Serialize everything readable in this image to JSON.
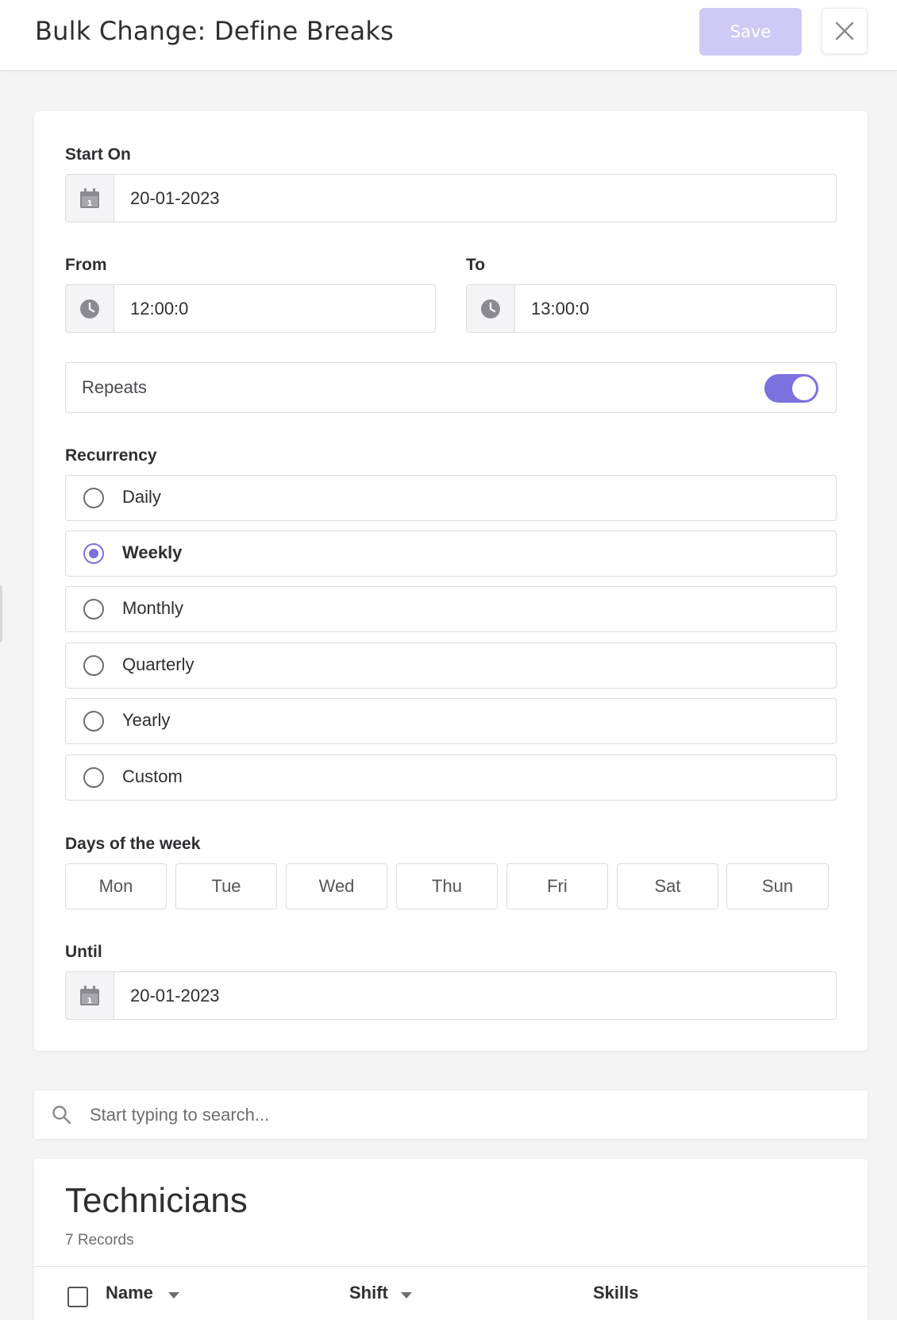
{
  "header": {
    "title": "Bulk Change: Define Breaks",
    "save_label": "Save",
    "close_icon": "close-icon"
  },
  "form": {
    "start_on_label": "Start On",
    "start_on_value": "20-01-2023",
    "from_label": "From",
    "from_value": "12:00:0",
    "to_label": "To",
    "to_value": "13:00:0",
    "repeats_label": "Repeats",
    "repeats_on": true,
    "recurrency_label": "Recurrency",
    "recurrency_options": [
      {
        "label": "Daily",
        "selected": false
      },
      {
        "label": "Weekly",
        "selected": true
      },
      {
        "label": "Monthly",
        "selected": false
      },
      {
        "label": "Quarterly",
        "selected": false
      },
      {
        "label": "Yearly",
        "selected": false
      },
      {
        "label": "Custom",
        "selected": false
      }
    ],
    "days_label": "Days of the week",
    "days": [
      "Mon",
      "Tue",
      "Wed",
      "Thu",
      "Fri",
      "Sat",
      "Sun"
    ],
    "until_label": "Until",
    "until_value": "20-01-2023"
  },
  "search": {
    "placeholder": "Start typing to search...",
    "value": ""
  },
  "technicians": {
    "title": "Technicians",
    "count": "7 Records",
    "columns": [
      "Name",
      "Shift",
      "Skills"
    ]
  },
  "colors": {
    "accent": "#7b72e0",
    "save_disabled": "#cdcaf6",
    "background": "#f4f4f5"
  }
}
